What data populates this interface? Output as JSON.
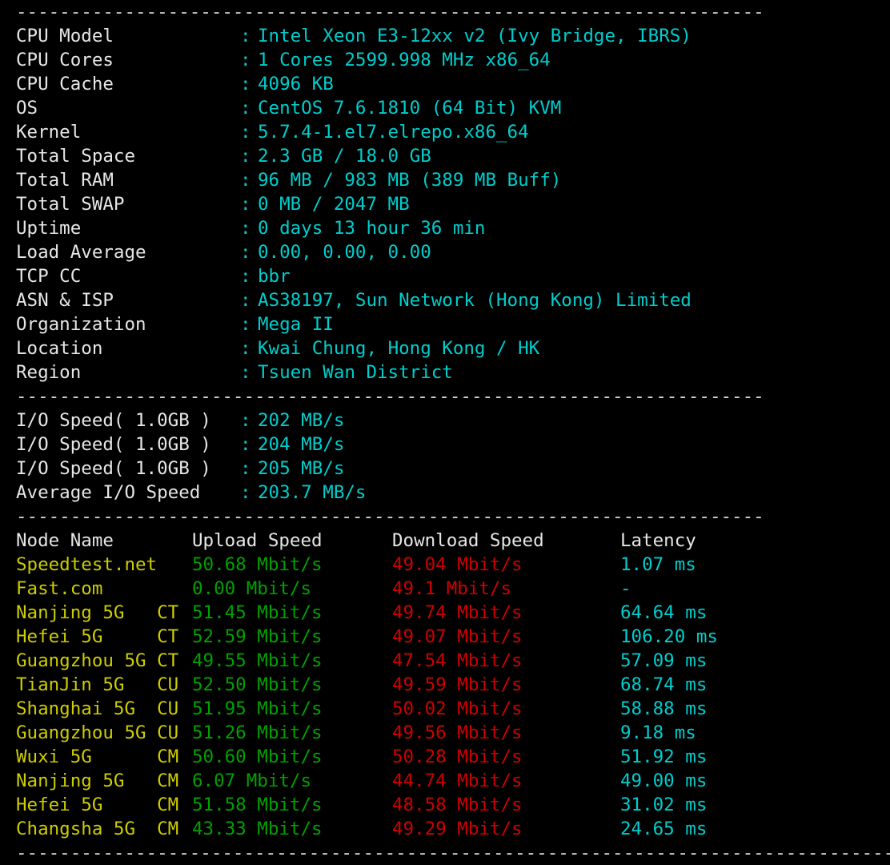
{
  "terminal": {
    "background_color": "#000000",
    "palette": {
      "white": "#e6e6e6",
      "cyan": "#00cdcd",
      "yellow": "#cdcd00",
      "green": "#00a000",
      "red": "#cd0000",
      "separator": "#d8d8d8"
    },
    "separator_short": "---------------------------------------------------------------------",
    "separator_long": "----------------------------------------------------------------------------------"
  },
  "system_info": {
    "rows": [
      {
        "label": "CPU Model",
        "colon": ":",
        "value_cyan_1": "Intel Xeon E3-12xx v2 (Ivy Bridge, IBRS)",
        "value_yellow": "",
        "value_cyan_2": ""
      },
      {
        "label": "CPU Cores",
        "colon": ":",
        "value_cyan_1": "",
        "value_yellow": "1 Cores",
        "value_cyan_2": " 2599.998 MHz x86_64"
      },
      {
        "label": "CPU Cache",
        "colon": ":",
        "value_cyan_1": "4096 KB",
        "value_yellow": "",
        "value_cyan_2": ""
      },
      {
        "label": "OS",
        "colon": ":",
        "value_cyan_1": "CentOS 7.6.1810 (64 Bit) ",
        "value_yellow": "KVM",
        "value_cyan_2": ""
      },
      {
        "label": "Kernel",
        "colon": ":",
        "value_cyan_1": "5.7.4-1.el7.elrepo.x86_64",
        "value_yellow": "",
        "value_cyan_2": ""
      },
      {
        "label": "Total Space",
        "colon": ":",
        "value_cyan_1": "2.3 GB / ",
        "value_yellow": "18.0 GB",
        "value_cyan_2": ""
      },
      {
        "label": "Total RAM",
        "colon": ":",
        "value_cyan_1": "96 MB / ",
        "value_yellow": "983 MB",
        "value_cyan_2": " (389 MB Buff)"
      },
      {
        "label": "Total SWAP",
        "colon": ":",
        "value_cyan_1": "0 MB / 2047 MB",
        "value_yellow": "",
        "value_cyan_2": ""
      },
      {
        "label": "Uptime",
        "colon": ":",
        "value_cyan_1": "0 days 13 hour 36 min",
        "value_yellow": "",
        "value_cyan_2": ""
      },
      {
        "label": "Load Average",
        "colon": ":",
        "value_cyan_1": "0.00, 0.00, 0.00",
        "value_yellow": "",
        "value_cyan_2": ""
      },
      {
        "label": "TCP CC",
        "colon": ":",
        "value_cyan_1": "",
        "value_yellow": "bbr",
        "value_cyan_2": ""
      },
      {
        "label": "ASN & ISP",
        "colon": ":",
        "value_cyan_1": "AS38197, Sun Network (Hong Kong) Limited",
        "value_yellow": "",
        "value_cyan_2": ""
      },
      {
        "label": "Organization",
        "colon": ":",
        "value_cyan_1": "",
        "value_yellow": "Mega II",
        "value_cyan_2": ""
      },
      {
        "label": "Location",
        "colon": ":",
        "value_cyan_1": "Kwai Chung, ",
        "value_yellow": "Hong Kong / HK",
        "value_cyan_2": ""
      },
      {
        "label": "Region",
        "colon": ":",
        "value_cyan_1": "Tsuen Wan District",
        "value_yellow": "",
        "value_cyan_2": ""
      }
    ]
  },
  "io_speed": {
    "rows": [
      {
        "label": "I/O Speed( 1.0GB )",
        "colon": ":",
        "value": "202 MB/s"
      },
      {
        "label": "I/O Speed( 1.0GB )",
        "colon": ":",
        "value": "204 MB/s"
      },
      {
        "label": "I/O Speed( 1.0GB )",
        "colon": ":",
        "value": "205 MB/s"
      },
      {
        "label": "Average I/O Speed",
        "colon": ":",
        "value": "203.7 MB/s"
      }
    ]
  },
  "speedtest": {
    "headers": {
      "node": "Node Name",
      "upload": "Upload Speed",
      "download": "Download Speed",
      "latency": "Latency"
    },
    "rows": [
      {
        "node": "Speedtest.net",
        "upload": "50.68 Mbit/s",
        "download": "49.04 Mbit/s",
        "latency": "1.07 ms"
      },
      {
        "node": "Fast.com",
        "upload": "0.00 Mbit/s",
        "download": "49.1 Mbit/s",
        "latency": "-"
      },
      {
        "node": "Nanjing 5G   CT",
        "upload": "51.45 Mbit/s",
        "download": "49.74 Mbit/s",
        "latency": "64.64 ms"
      },
      {
        "node": "Hefei 5G     CT",
        "upload": "52.59 Mbit/s",
        "download": "49.07 Mbit/s",
        "latency": "106.20 ms"
      },
      {
        "node": "Guangzhou 5G CT",
        "upload": "49.55 Mbit/s",
        "download": "47.54 Mbit/s",
        "latency": "57.09 ms"
      },
      {
        "node": "TianJin 5G   CU",
        "upload": "52.50 Mbit/s",
        "download": "49.59 Mbit/s",
        "latency": "68.74 ms"
      },
      {
        "node": "Shanghai 5G  CU",
        "upload": "51.95 Mbit/s",
        "download": "50.02 Mbit/s",
        "latency": "58.88 ms"
      },
      {
        "node": "Guangzhou 5G CU",
        "upload": "51.26 Mbit/s",
        "download": "49.56 Mbit/s",
        "latency": "9.18 ms"
      },
      {
        "node": "Wuxi 5G      CM",
        "upload": "50.60 Mbit/s",
        "download": "50.28 Mbit/s",
        "latency": "51.92 ms"
      },
      {
        "node": "Nanjing 5G   CM",
        "upload": "6.07 Mbit/s",
        "download": "44.74 Mbit/s",
        "latency": "49.00 ms"
      },
      {
        "node": "Hefei 5G     CM",
        "upload": "51.58 Mbit/s",
        "download": "48.58 Mbit/s",
        "latency": "31.02 ms"
      },
      {
        "node": "Changsha 5G  CM",
        "upload": "43.33 Mbit/s",
        "download": "49.29 Mbit/s",
        "latency": "24.65 ms"
      }
    ]
  }
}
